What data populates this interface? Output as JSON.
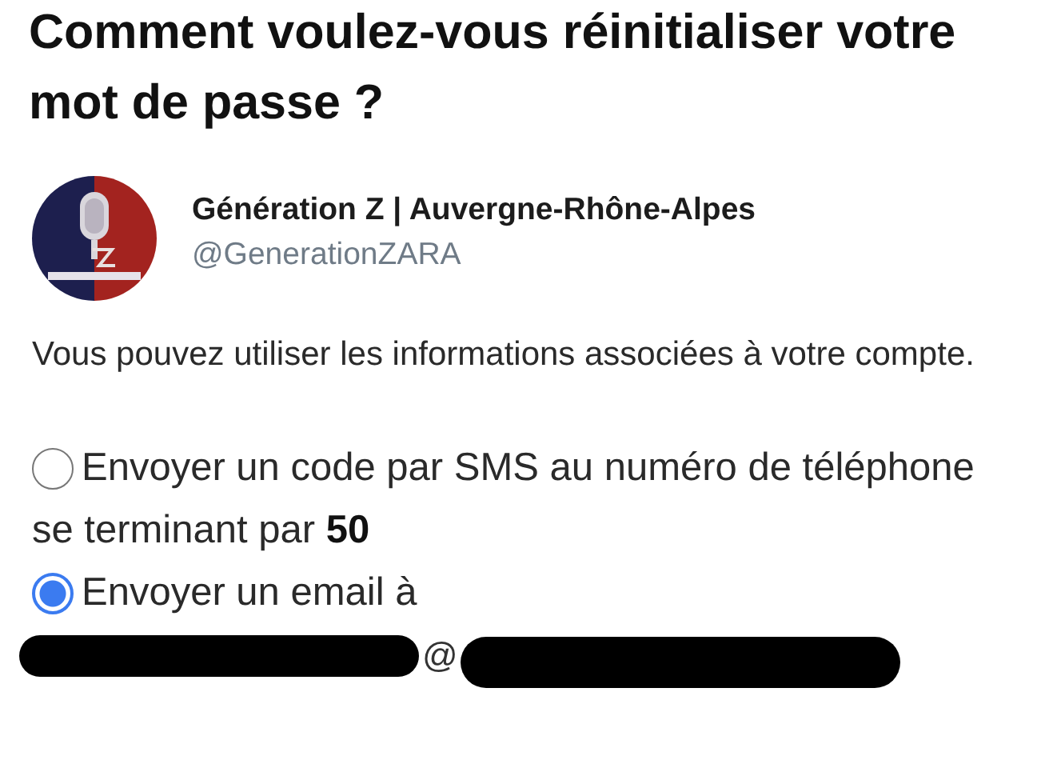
{
  "title": "Comment voulez-vous réinitialiser votre mot de passe ?",
  "account": {
    "name": "Génération Z | Auvergne-Rhône-Alpes",
    "handle": "@GenerationZARA"
  },
  "description": "Vous pouvez utiliser les informations associées à votre compte.",
  "options": [
    {
      "label_lines": [
        "Envoyer un code par SMS au numéro de téléphone",
        "se terminant par **50**"
      ],
      "selected": false
    },
    {
      "label_lines": [
        "Envoyer un email à"
      ],
      "selected": true
    }
  ],
  "email": {
    "visible_part": "@",
    "redacted": true
  }
}
